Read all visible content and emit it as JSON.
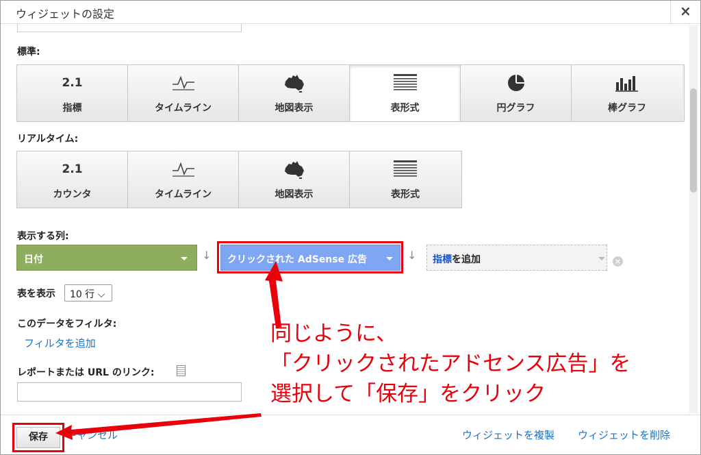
{
  "dialog": {
    "title": "ウィジェットの設定",
    "close_label": "×"
  },
  "standard": {
    "label": "標準:",
    "items": [
      {
        "icon_text": "2.1",
        "label": "指標",
        "icon": "metric-number-icon",
        "active": false
      },
      {
        "icon_text": "",
        "label": "タイムライン",
        "icon": "timeline-icon",
        "active": false
      },
      {
        "icon_text": "",
        "label": "地図表示",
        "icon": "australia-map-icon",
        "active": false
      },
      {
        "icon_text": "",
        "label": "表形式",
        "icon": "table-icon",
        "active": true
      },
      {
        "icon_text": "",
        "label": "円グラフ",
        "icon": "pie-chart-icon",
        "active": false
      },
      {
        "icon_text": "",
        "label": "棒グラフ",
        "icon": "bar-chart-icon",
        "active": false
      }
    ]
  },
  "realtime": {
    "label": "リアルタイム:",
    "items": [
      {
        "icon_text": "2.1",
        "label": "カウンタ",
        "icon": "counter-number-icon"
      },
      {
        "icon_text": "",
        "label": "タイムライン",
        "icon": "timeline-icon"
      },
      {
        "icon_text": "",
        "label": "地図表示",
        "icon": "australia-map-icon"
      },
      {
        "icon_text": "",
        "label": "表形式",
        "icon": "table-icon"
      }
    ]
  },
  "columns": {
    "label": "表示する列:",
    "dimension": "日付",
    "metric_selected": "クリックされた AdSense 広告",
    "add_metric_link": "指標",
    "add_metric_suffix": "を追加"
  },
  "rows": {
    "label": "表を表示",
    "value": "10 行 ⌵"
  },
  "filter": {
    "label": "このデータをフィルタ:",
    "add_link": "フィルタを追加"
  },
  "report_link": {
    "label": "レポートまたは URL のリンク:",
    "value": ""
  },
  "footer": {
    "save": "保存",
    "cancel": "キャンセル",
    "duplicate": "ウィジェットを複製",
    "delete": "ウィジェットを削除"
  },
  "annotation": {
    "line1": "同じように、",
    "line2": "「クリックされたアドセンス広告」を",
    "line3": "選択して「保存」をクリック"
  },
  "colors": {
    "annotation_red": "#e8000b",
    "date_green": "#8fad5f",
    "metric_blue": "#7ea6f3",
    "link_blue": "#1a73c8"
  }
}
